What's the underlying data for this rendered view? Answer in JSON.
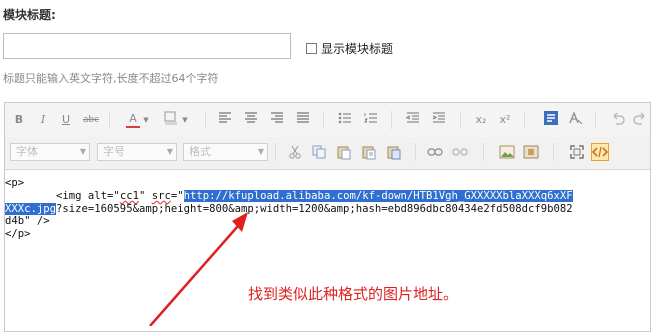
{
  "form": {
    "title_label": "模块标题:",
    "title_input_value": "",
    "show_title_checkbox_label": "显示模块标题",
    "show_title_checked": false,
    "hint": "标题只能输入英文字符,长度不超过64个字符"
  },
  "toolbar": {
    "row1_buttons": [
      "B",
      "I",
      "U",
      "abc",
      "A",
      "x₂",
      "x²"
    ],
    "font_select": "字体",
    "size_select": "字号",
    "format_select": "格式"
  },
  "code": {
    "line1": "<p>",
    "line2_prefix": "        <img alt=\"",
    "line2_alt": "cc1",
    "line2_mid": "\" ",
    "line2_src_attr": "src",
    "line2_eq": "=\"",
    "line2_url_sel": "http://kfupload.alibaba.com/kf-down/HTB1Vgh_GXXXXXblaXXXq6xXF",
    "line3_url_sel": "XXXc.jpg",
    "line3_rest": "?size=160595&amp;height=800&amp;width=1200&amp;hash=ebd896dbc80434e2fd508dcf9b082",
    "line4": "d4b\" />",
    "line5": "</p>"
  },
  "annotation": "找到类似此种格式的图片地址。",
  "colors": {
    "arrow": "#e02020",
    "selection": "#2f6fd0",
    "active_button": "#fde8b0"
  }
}
